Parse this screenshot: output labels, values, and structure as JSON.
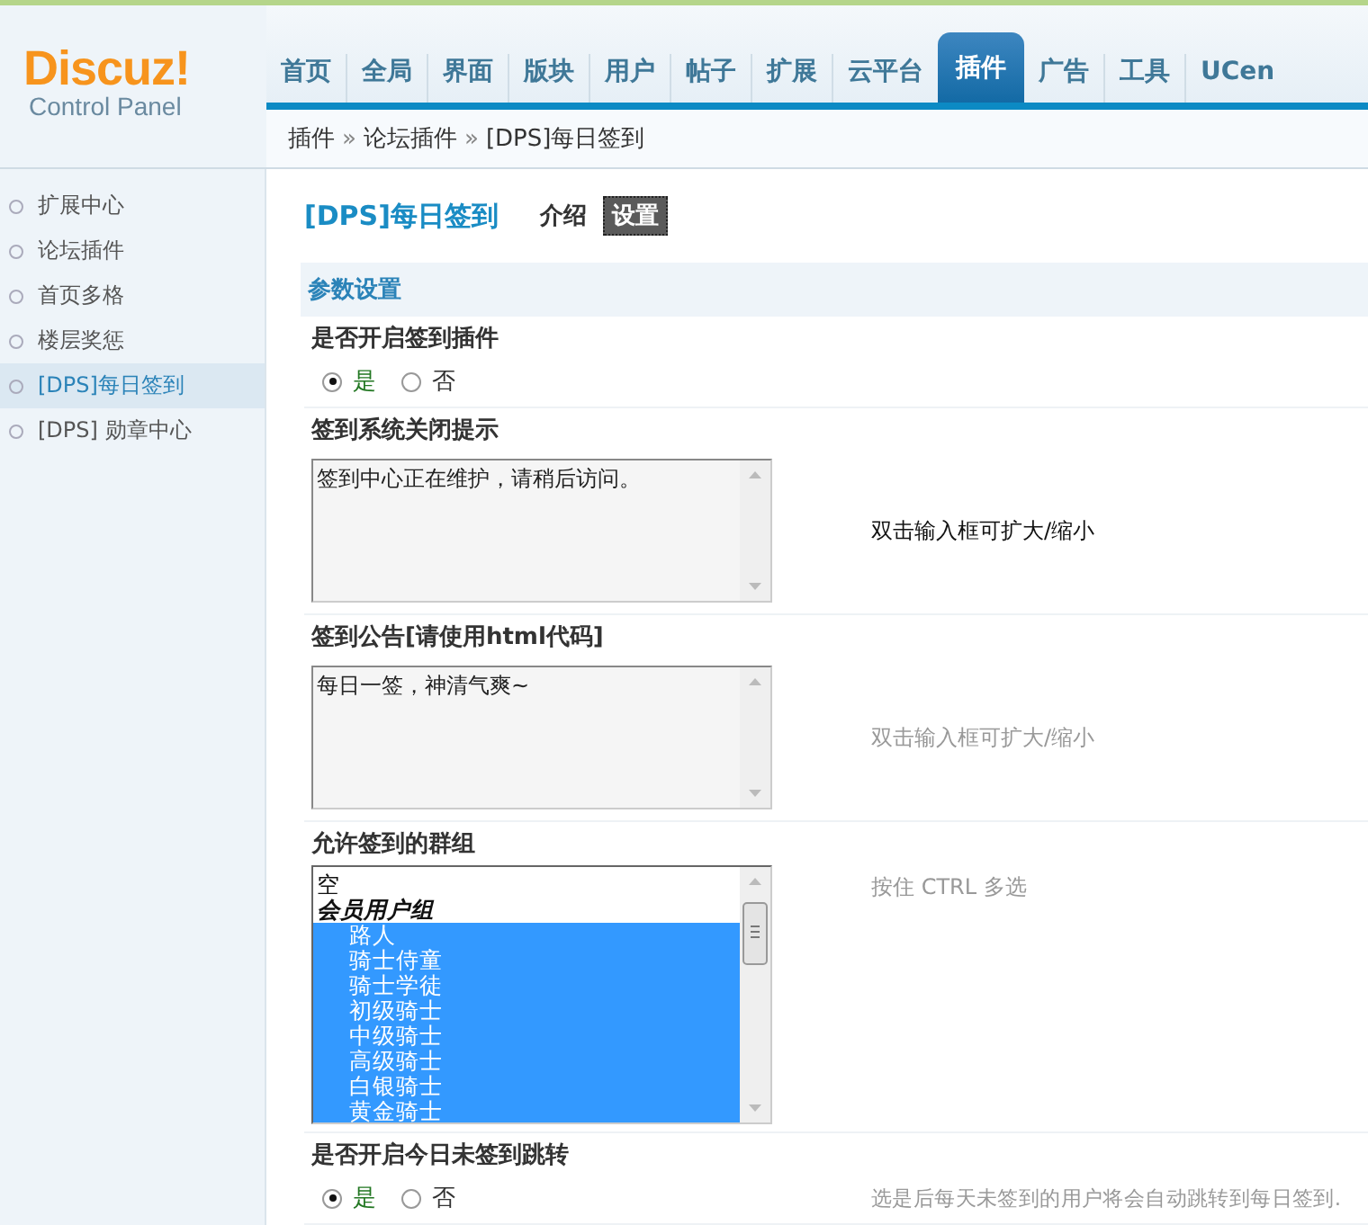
{
  "logo": {
    "name": "Discuz!",
    "subtitle": "Control Panel"
  },
  "nav": [
    {
      "label": "首页",
      "selected": false
    },
    {
      "label": "全局",
      "selected": false
    },
    {
      "label": "界面",
      "selected": false
    },
    {
      "label": "版块",
      "selected": false
    },
    {
      "label": "用户",
      "selected": false
    },
    {
      "label": "帖子",
      "selected": false
    },
    {
      "label": "扩展",
      "selected": false
    },
    {
      "label": "云平台",
      "selected": false
    },
    {
      "label": "插件",
      "selected": true
    },
    {
      "label": "广告",
      "selected": false
    },
    {
      "label": "工具",
      "selected": false
    },
    {
      "label": "UCen",
      "selected": false
    }
  ],
  "breadcrumb": [
    "插件",
    "»",
    "论坛插件",
    "»",
    "[DPS]每日签到"
  ],
  "sidebar": {
    "items": [
      {
        "label": "扩展中心",
        "selected": false
      },
      {
        "label": "论坛插件",
        "selected": false
      },
      {
        "label": "首页多格",
        "selected": false
      },
      {
        "label": "楼层奖惩",
        "selected": false
      },
      {
        "label": "[DPS]每日签到",
        "selected": true
      },
      {
        "label": "[DPS] 勋章中心",
        "selected": false
      }
    ]
  },
  "page": {
    "title": "[DPS]每日签到",
    "tabs": [
      {
        "label": "介绍",
        "selected": false
      },
      {
        "label": "设置",
        "selected": true
      }
    ]
  },
  "section": {
    "title": "参数设置"
  },
  "settings": [
    {
      "kind": "radio",
      "label": "是否开启签到插件",
      "options": [
        {
          "label": "是",
          "selected": true
        },
        {
          "label": "否",
          "selected": false
        }
      ]
    },
    {
      "kind": "textarea",
      "label": "签到系统关闭提示",
      "value": "签到中心正在维护，请稍后访问。",
      "hint": "双击输入框可扩大/缩小",
      "hint_active": true
    },
    {
      "kind": "textarea",
      "label": "签到公告[请使用html代码]",
      "value": "每日一签，神清气爽~",
      "hint": "双击输入框可扩大/缩小",
      "hint_active": false
    },
    {
      "kind": "select",
      "label": "允许签到的群组",
      "hint": "按住  CTRL 多选",
      "hint_active": false,
      "options": [
        {
          "kind": "option",
          "label": "空",
          "selected": false
        },
        {
          "kind": "group",
          "label": "会员用户组"
        },
        {
          "kind": "option",
          "label": "路人",
          "selected": true
        },
        {
          "kind": "option",
          "label": "骑士侍童",
          "selected": true
        },
        {
          "kind": "option",
          "label": "骑士学徒",
          "selected": true
        },
        {
          "kind": "option",
          "label": "初级骑士",
          "selected": true
        },
        {
          "kind": "option",
          "label": "中级骑士",
          "selected": true
        },
        {
          "kind": "option",
          "label": "高级骑士",
          "selected": true
        },
        {
          "kind": "option",
          "label": "白银骑士",
          "selected": true
        },
        {
          "kind": "option",
          "label": "黄金骑士",
          "selected": true
        }
      ]
    },
    {
      "kind": "radio",
      "label": "是否开启今日未签到跳转",
      "options": [
        {
          "label": "是",
          "selected": true
        },
        {
          "label": "否",
          "selected": false
        }
      ],
      "hint": "选是后每天未签到的用户将会自动跳转到每日签到.",
      "hint_active": false
    }
  ]
}
